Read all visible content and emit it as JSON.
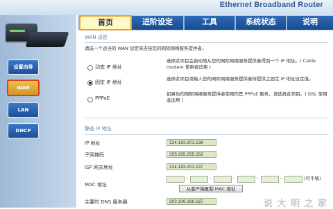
{
  "header": {
    "brand": "Ethernet Broadband Router"
  },
  "tabs": [
    {
      "label": "首页",
      "active": true
    },
    {
      "label": "进阶设定",
      "active": false
    },
    {
      "label": "工具",
      "active": false
    },
    {
      "label": "系统状态",
      "active": false
    },
    {
      "label": "说明",
      "active": false
    }
  ],
  "sidebar": {
    "items": [
      {
        "label": "设置向导",
        "active": false
      },
      {
        "label": "WAN",
        "active": true
      },
      {
        "label": "LAN",
        "active": false
      },
      {
        "label": "DHCP",
        "active": false
      }
    ]
  },
  "wan": {
    "section_title": "WAN 设定",
    "intro": "请选一个适当的 WAN 设定来连接您的网际网络服务提供者。",
    "options": [
      {
        "label": "动态 IP 地址",
        "selected": false,
        "desc": "选择此项目会自动地从您的网际网络服务提供者得到一个 IP 地址。( Cable modem 使用者适用 )"
      },
      {
        "label": "固定 IP 地址",
        "selected": true,
        "desc": "选择此项目请输入您的网际网络服务提供者所提供之固定 IP 地址设定值。"
      },
      {
        "label": "PPPoE",
        "selected": false,
        "desc": "如果你的网际网络服务提供者使用的是 PPPoE 服务，请选择此项目。( DSL 使用者适用 )"
      }
    ]
  },
  "static": {
    "section_title": "静态 IP 地址",
    "fields": [
      {
        "label": "IP 地址",
        "value": "124.193.201.138"
      },
      {
        "label": "子网掩码",
        "value": "255.255.255.252"
      },
      {
        "label": "ISP 网关地址",
        "value": "124.193.201.137"
      }
    ],
    "mac_label": "MAC 地址",
    "mac_optional": "(可不填)",
    "clone_button": "从客户端复制 MAC 地址",
    "dns_label": "主要的 DNS 服务器",
    "dns_value": "202.106.196.115"
  },
  "watermark": "说 大 明 之 家",
  "colors": {
    "tab_blue": "#1d5aa5",
    "active_outline": "#e43a1d",
    "field_bg": "#dbe9c9"
  }
}
